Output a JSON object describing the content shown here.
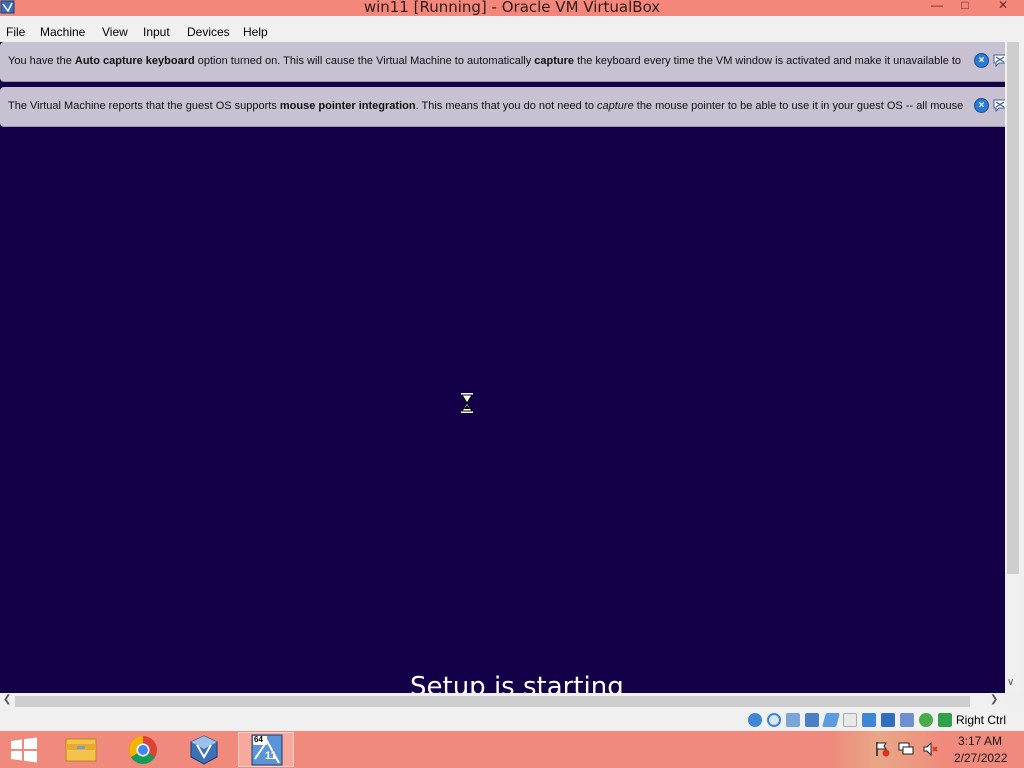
{
  "window": {
    "title": "win11 [Running] - Oracle VM VirtualBox",
    "icon": "virtualbox-icon",
    "controls": [
      "minimize-icon",
      "maximize-icon",
      "close-icon"
    ]
  },
  "menu": {
    "items": [
      "File",
      "Machine",
      "View",
      "Input",
      "Devices",
      "Help"
    ]
  },
  "notices": [
    {
      "parts": [
        {
          "text": "You have the ",
          "style": "normal"
        },
        {
          "text": "Auto capture keyboard",
          "style": "bold"
        },
        {
          "text": " option turned on. This will cause the Virtual Machine to automatically ",
          "style": "normal"
        },
        {
          "text": "capture",
          "style": "bold"
        },
        {
          "text": " the keyboard every time the VM window is activated and make it unavailable to",
          "style": "normal"
        }
      ]
    },
    {
      "parts": [
        {
          "text": "The Virtual Machine reports that the guest OS supports ",
          "style": "normal"
        },
        {
          "text": "mouse pointer integration",
          "style": "bold"
        },
        {
          "text": ". This means that you do not need to ",
          "style": "normal"
        },
        {
          "text": "capture",
          "style": "italic"
        },
        {
          "text": " the mouse pointer to be able to use it in your guest OS -- all mouse",
          "style": "normal"
        }
      ]
    }
  ],
  "guest": {
    "setup_text": "Setup is starting",
    "background": "#130048"
  },
  "statusbar": {
    "icons": [
      "hard-disk-icon",
      "optical-drive-icon",
      "audio-icon",
      "network-icon",
      "usb-icon",
      "shared-folder-icon",
      "display-icon",
      "recording-icon",
      "video-capture-icon",
      "cpu-icon",
      "mouse-integration-icon",
      "keyboard-capture-icon"
    ],
    "host_key": "Right Ctrl"
  },
  "taskbar": {
    "apps": [
      "windows-start-icon",
      "file-explorer-icon",
      "chrome-icon",
      "virtualbox-manager-icon",
      "win11-vm-icon"
    ],
    "vm_badge": "64",
    "vm_number": "11",
    "tray_icons": [
      "action-center-flag-icon",
      "network-icon",
      "volume-muted-icon"
    ],
    "time": "3:17 AM",
    "date": "2/27/2022"
  },
  "colors": {
    "titlebar": "#f5877a",
    "taskbar": "#f08a7c",
    "notice_bg": "#c7c1d1",
    "guest_bg": "#130048"
  }
}
